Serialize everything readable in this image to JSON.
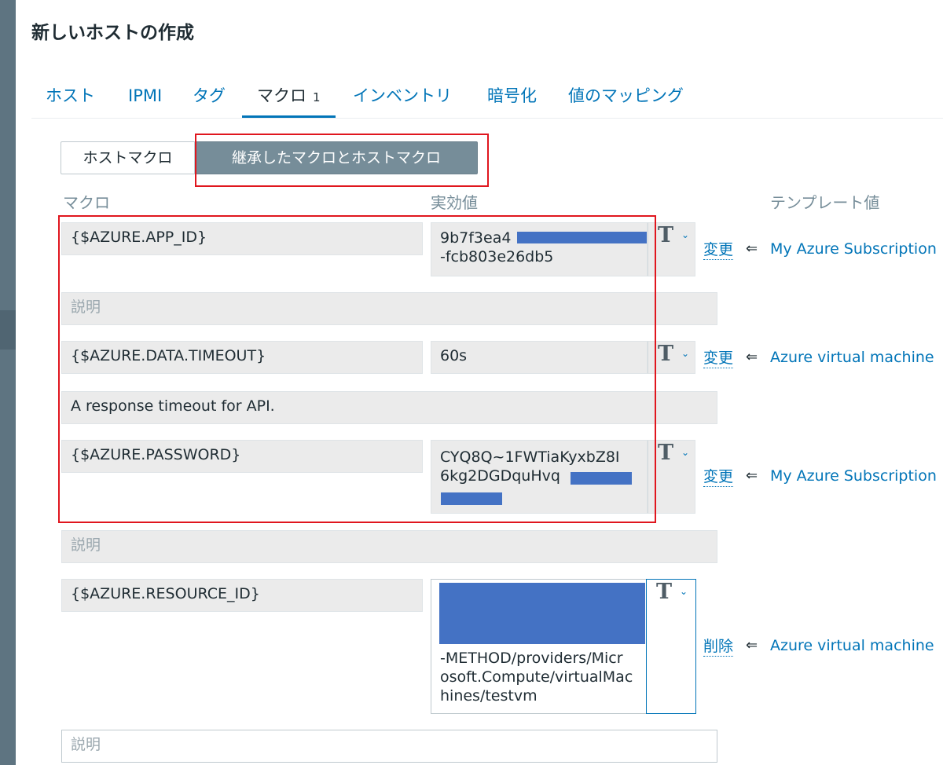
{
  "page": {
    "title": "新しいホストの作成"
  },
  "tabs": [
    {
      "label": "ホスト"
    },
    {
      "label": "IPMI"
    },
    {
      "label": "タグ"
    },
    {
      "label": "マクロ",
      "badge": "1"
    },
    {
      "label": "インベントリ"
    },
    {
      "label": "暗号化"
    },
    {
      "label": "値のマッピング"
    }
  ],
  "macro_mode": {
    "host_label": "ホストマクロ",
    "inherited_label": "継承したマクロとホストマクロ",
    "selected": "inherited"
  },
  "columns": {
    "macro": "マクロ",
    "effective": "実効値",
    "template": "テンプレート値"
  },
  "description_placeholder": "説明",
  "rows": [
    {
      "macro": "{$AZURE.APP_ID}",
      "value_lines": [
        "9b7f3ea4",
        "-fcb803e26db5"
      ],
      "description": "",
      "action": "変更",
      "template": "My Azure Subscription"
    },
    {
      "macro": "{$AZURE.DATA.TIMEOUT}",
      "value_lines": [
        "60s"
      ],
      "description": "A response timeout for API.",
      "action": "変更",
      "template": "Azure virtual machine"
    },
    {
      "macro": "{$AZURE.PASSWORD}",
      "value_lines": [
        "CYQ8Q~1FWTiaKyxbZ8I",
        "6kg2DGDquHvq"
      ],
      "description": "",
      "action": "変更",
      "template": "My Azure Subscription"
    },
    {
      "macro": "{$AZURE.RESOURCE_ID}",
      "value_lines": [
        "-METHOD/providers/Micr",
        "osoft.Compute/virtualMac",
        "hines/testvm"
      ],
      "description": "",
      "action": "削除",
      "template": "Azure virtual machine"
    }
  ],
  "icons": {
    "type_selector": "T",
    "chevron": "⌄",
    "arrow": "⇐"
  },
  "colors": {
    "accent": "#0275b8",
    "redaction": "#4472c4",
    "highlight": "#e0161e",
    "selected_segment": "#768d99"
  }
}
